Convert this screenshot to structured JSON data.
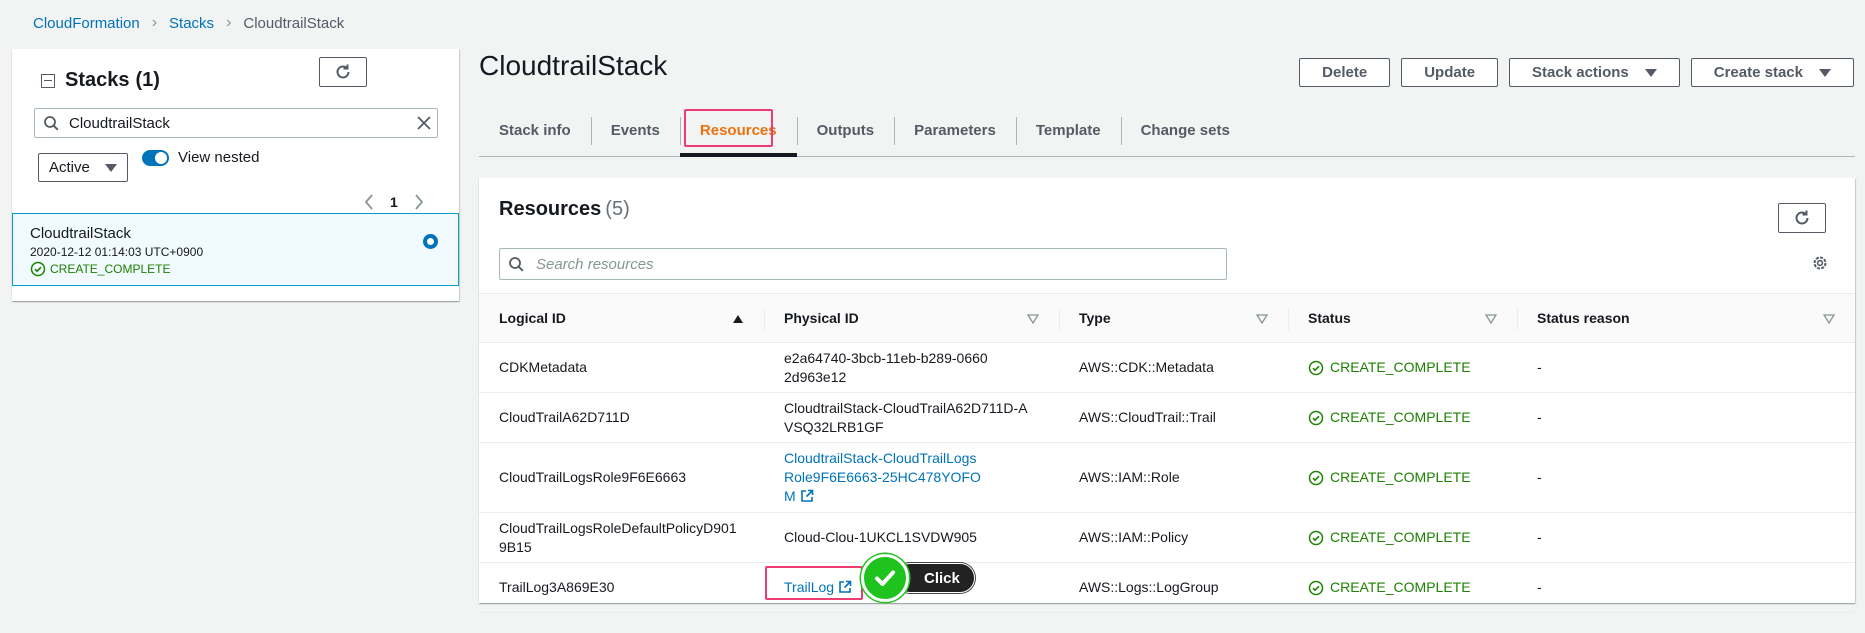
{
  "breadcrumb": {
    "root": "CloudFormation",
    "stacks": "Stacks",
    "current": "CloudtrailStack"
  },
  "left": {
    "title": "Stacks",
    "count": "(1)",
    "search_value": "CloudtrailStack",
    "filter_selected": "Active",
    "toggle_label": "View nested",
    "page": "1",
    "stack": {
      "name": "CloudtrailStack",
      "date": "2020-12-12 01:14:03 UTC+0900",
      "status": "CREATE_COMPLETE"
    }
  },
  "main": {
    "title": "CloudtrailStack",
    "actions": {
      "delete": "Delete",
      "update": "Update",
      "stack_actions": "Stack actions",
      "create_stack": "Create stack"
    },
    "tabs": [
      "Stack info",
      "Events",
      "Resources",
      "Outputs",
      "Parameters",
      "Template",
      "Change sets"
    ]
  },
  "resources": {
    "title": "Resources",
    "count": "(5)",
    "search_placeholder": "Search resources",
    "columns": [
      "Logical ID",
      "Physical ID",
      "Type",
      "Status",
      "Status reason"
    ],
    "rows": [
      {
        "logical": "CDKMetadata",
        "physical": "e2a64740-3bcb-11eb-b289-06602d963e12",
        "type": "AWS::CDK::Metadata",
        "status": "CREATE_COMPLETE",
        "reason": "-"
      },
      {
        "logical": "CloudTrailA62D711D",
        "physical": "CloudtrailStack-CloudTrailA62D711D-AVSQ32LRB1GF",
        "type": "AWS::CloudTrail::Trail",
        "status": "CREATE_COMPLETE",
        "reason": "-"
      },
      {
        "logical": "CloudTrailLogsRole9F6E6663",
        "physical": "CloudtrailStack-CloudTrailLogsRole9F6E6663-25HC478YOFOM",
        "type": "AWS::IAM::Role",
        "status": "CREATE_COMPLETE",
        "reason": "-"
      },
      {
        "logical": "CloudTrailLogsRoleDefaultPolicyD9019B15",
        "physical": "Cloud-Clou-1UKCL1SVDW905",
        "type": "AWS::IAM::Policy",
        "status": "CREATE_COMPLETE",
        "reason": "-"
      },
      {
        "logical": "TrailLog3A869E30",
        "physical": "TrailLog",
        "type": "AWS::Logs::LogGroup",
        "status": "CREATE_COMPLETE",
        "reason": "-"
      }
    ]
  },
  "annotation": {
    "click_label": "Click"
  },
  "colors": {
    "link": "#0073bb",
    "active_tab": "#ec7211",
    "success": "#1d8102",
    "highlight": "#ec3c72",
    "click_green": "#1ec31e"
  }
}
